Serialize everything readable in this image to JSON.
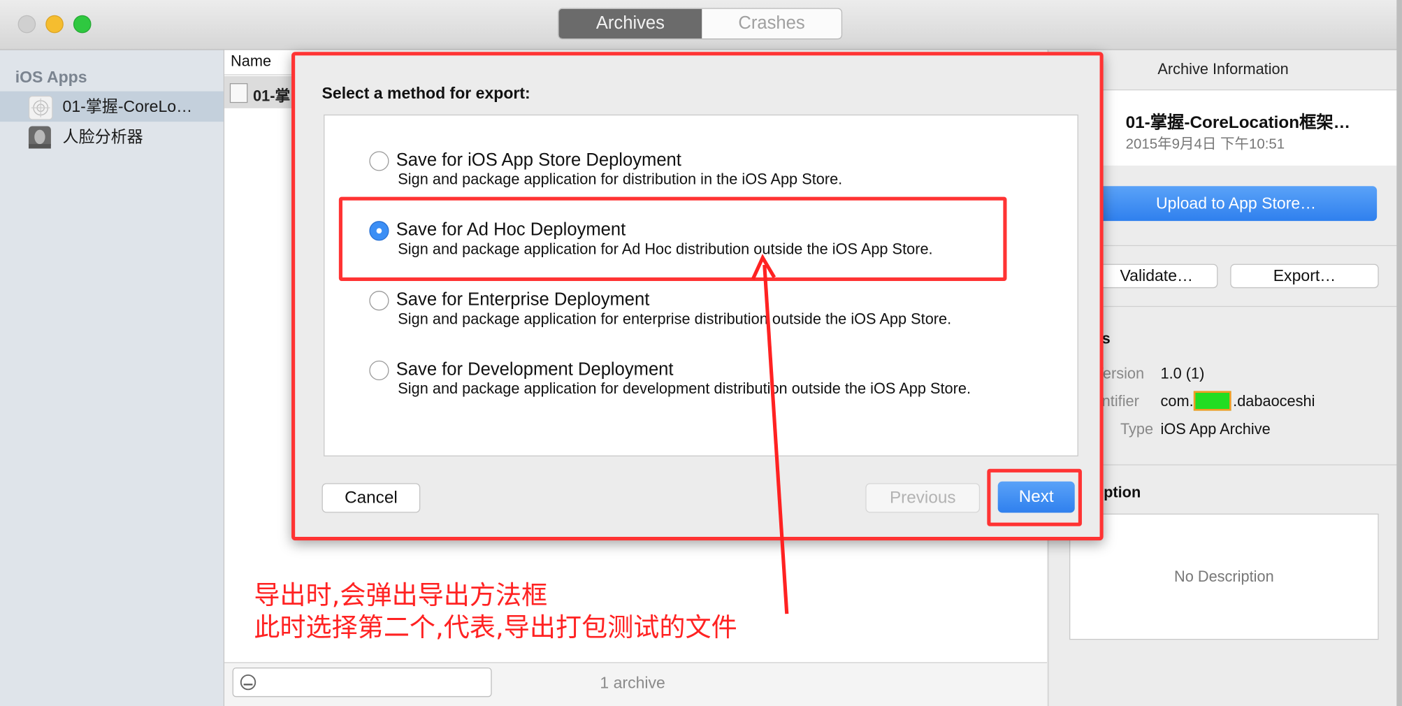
{
  "tabs": [
    "Archives",
    "Crashes"
  ],
  "sidebar": {
    "header": "iOS Apps",
    "items": [
      "01-掌握-CoreLo…",
      "人脸分析器"
    ]
  },
  "list": {
    "column": "Name",
    "row": "01-掌",
    "search_placeholder": "",
    "count": "1 archive"
  },
  "info": {
    "header": "Archive Information",
    "name": "01-掌握-CoreLocation框架…",
    "date": "2015年9月4日 下午10:51",
    "upload": "Upload to App Store…",
    "validate": "Validate…",
    "export": "Export…",
    "details_header": "ils",
    "version_label": "Version",
    "version_value": "1.0 (1)",
    "identifier_label": "entifier",
    "identifier_prefix": "com.",
    "identifier_suffix": ".dabaoceshi",
    "type_label": "Type",
    "type_value": "iOS App Archive",
    "description_header": "ription",
    "no_description": "No Description"
  },
  "dialog": {
    "title": "Select a method for export:",
    "options": [
      {
        "label": "Save for iOS App Store Deployment",
        "desc": "Sign and package application for distribution in the iOS App Store."
      },
      {
        "label": "Save for Ad Hoc Deployment",
        "desc": "Sign and package application for Ad Hoc distribution outside the iOS App Store."
      },
      {
        "label": "Save for Enterprise Deployment",
        "desc": "Sign and package application for enterprise distribution outside the iOS App Store."
      },
      {
        "label": "Save for Development Deployment",
        "desc": "Sign and package application for development distribution outside the iOS App Store."
      }
    ],
    "selected_index": 1,
    "cancel": "Cancel",
    "previous": "Previous",
    "next": "Next"
  },
  "annotation": {
    "line1": "导出时,会弹出导出方法框",
    "line2": "此时选择第二个,代表,导出打包测试的文件"
  },
  "colors": {
    "accent": "#3b8ef5",
    "annotation": "#ff3333",
    "redacted": "#22dd22"
  }
}
